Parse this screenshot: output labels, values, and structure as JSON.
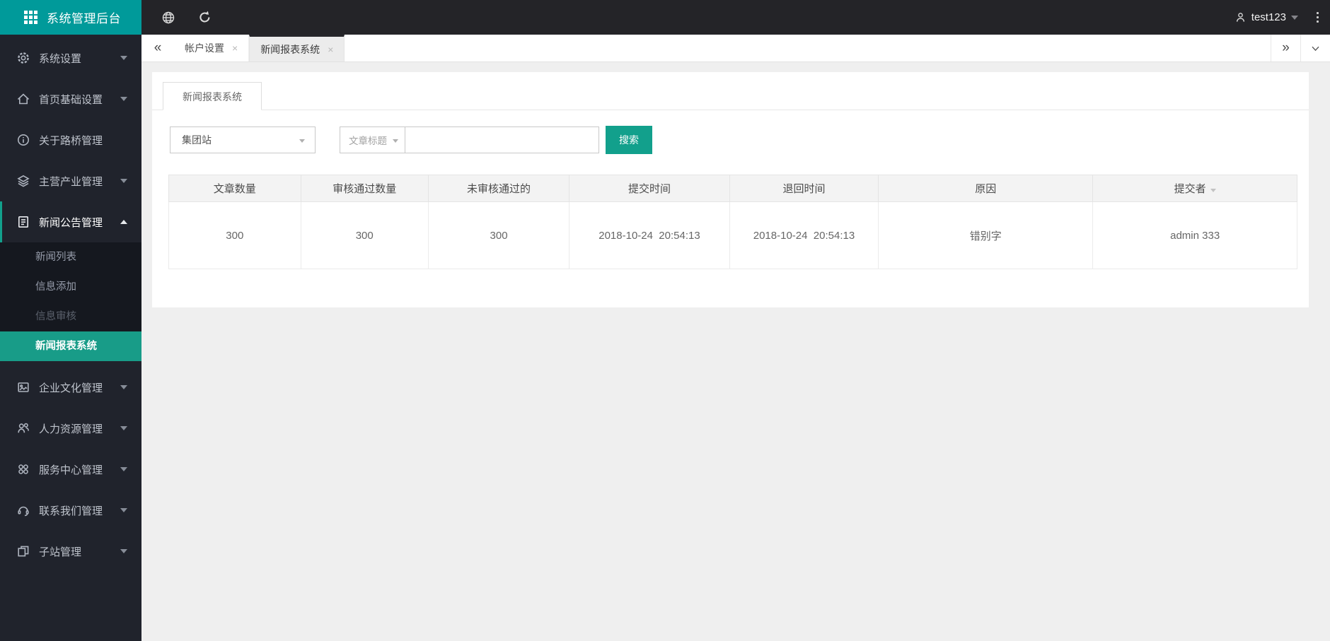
{
  "app": {
    "title": "系统管理后台"
  },
  "topbar": {
    "icons": [
      "globe-icon",
      "refresh-icon",
      "user-icon",
      "caret-down-icon",
      "kebab-menu-icon"
    ],
    "username": "test123"
  },
  "tabbar": {
    "scroll_left": "«",
    "scroll_right": "»",
    "collapse": "chevron-down-icon",
    "close_glyph": "×",
    "tabs": [
      {
        "label": "帐户设置",
        "active": false
      },
      {
        "label": "新闻报表系统",
        "active": true
      }
    ]
  },
  "sidebar": {
    "items": [
      {
        "label": "系统设置",
        "icon": "gear-icon",
        "expandable": true
      },
      {
        "label": "首页基础设置",
        "icon": "home-icon",
        "expandable": true
      },
      {
        "label": "关于路桥管理",
        "icon": "info-icon",
        "expandable": false
      },
      {
        "label": "主营产业管理",
        "icon": "layers-icon",
        "expandable": true
      },
      {
        "label": "新闻公告管理",
        "icon": "news-icon",
        "expandable": true,
        "expanded": true,
        "children": [
          {
            "label": "新闻列表",
            "state": "normal"
          },
          {
            "label": "信息添加",
            "state": "normal"
          },
          {
            "label": "信息审核",
            "state": "dimmed"
          },
          {
            "label": "新闻报表系统",
            "state": "active"
          }
        ]
      },
      {
        "label": "企业文化管理",
        "icon": "culture-icon",
        "expandable": true
      },
      {
        "label": "人力资源管理",
        "icon": "hr-users-icon",
        "expandable": true
      },
      {
        "label": "服务中心管理",
        "icon": "service-icon",
        "expandable": true
      },
      {
        "label": "联系我们管理",
        "icon": "contact-icon",
        "expandable": true
      },
      {
        "label": "子站管理",
        "icon": "subsite-icon",
        "expandable": true
      }
    ]
  },
  "panel": {
    "tab_label": "新闻报表系统"
  },
  "search": {
    "site_select_value": "集团站",
    "field_select_value": "文章标题",
    "keyword_value": "",
    "button_label": "搜索"
  },
  "report_table": {
    "headers": [
      "文章数量",
      "审核通过数量",
      "未审核通过的",
      "提交时间",
      "退回时间",
      "原因",
      "提交者"
    ],
    "sortable_header": "提交者",
    "rows": [
      [
        "300",
        "300",
        "300",
        "2018-10-24  20:54:13",
        "2018-10-24  20:54:13",
        "错别字",
        "admin 333"
      ]
    ]
  },
  "colors": {
    "brand_teal": "#009a9a",
    "accent_teal": "#12a08c",
    "topbar_bg": "#242428",
    "sidebar_bg": "#20232c",
    "submenu_bg": "#15181f",
    "content_bg": "#efefef"
  }
}
